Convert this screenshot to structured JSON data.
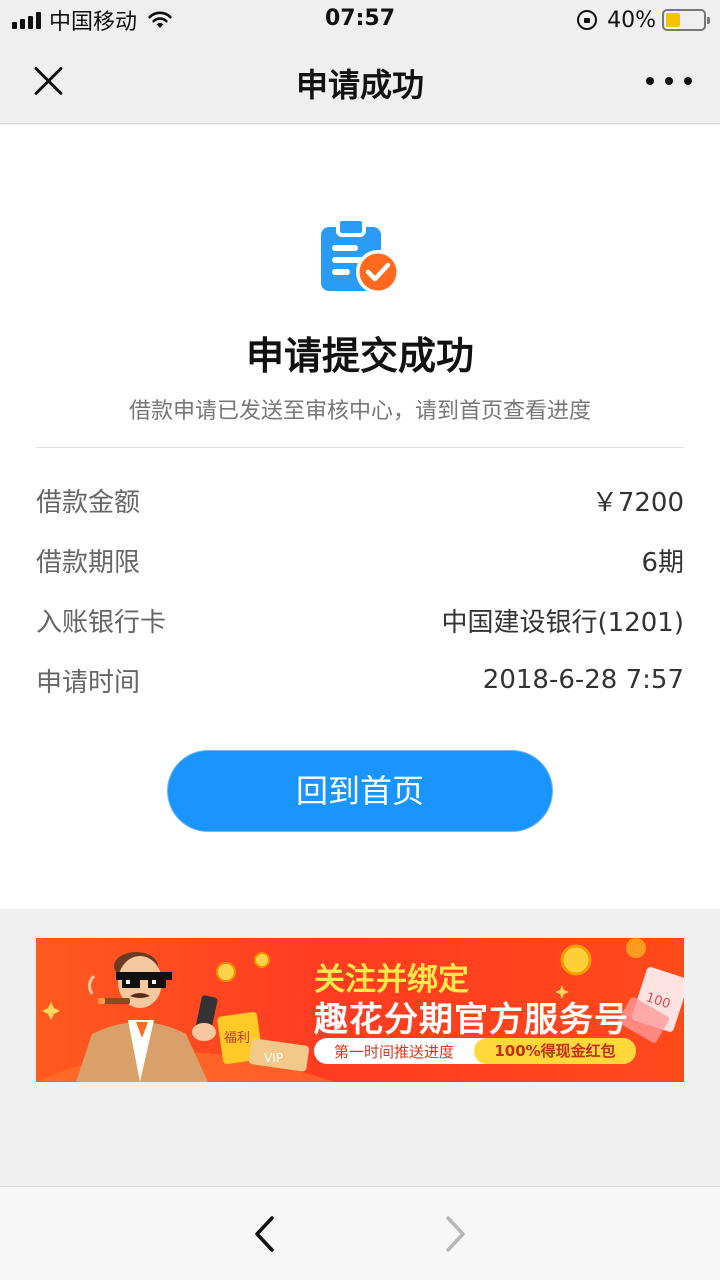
{
  "status_bar": {
    "carrier": "中国移动",
    "time": "07:57",
    "battery_percent": "40%",
    "battery_level": 0.4,
    "icons": [
      "signal-icon",
      "wifi-icon",
      "orientation-lock-icon",
      "battery-icon"
    ]
  },
  "nav": {
    "title": "申请成功",
    "close_icon": "close-icon",
    "more_icon": "more-icon"
  },
  "result": {
    "icon": "clipboard-check-icon",
    "title": "申请提交成功",
    "description": "借款申请已发送至审核中心，请到首页查看进度"
  },
  "details": [
    {
      "label": "借款金额",
      "value": "￥7200"
    },
    {
      "label": "借款期限",
      "value": "6期"
    },
    {
      "label": "入账银行卡",
      "value": "中国建设银行(1201)"
    },
    {
      "label": "申请时间",
      "value": "2018-6-28 7:57"
    }
  ],
  "home_button": {
    "label": "回到首页"
  },
  "banner": {
    "title_line1": "关注并绑定",
    "title_line2": "趣花分期官方服务号",
    "pill_left": "第一时间推送进度",
    "pill_right": "100%得现金红包",
    "badge_text": "福利",
    "vip_text": "VIP"
  },
  "toolbar": {
    "back_icon": "chevron-left-icon",
    "forward_icon": "chevron-right-icon"
  },
  "colors": {
    "accent_blue": "#1a95ff",
    "icon_blue": "#2b9cf5",
    "check_orange": "#ff6a1e",
    "banner_red": "#ff3b22",
    "battery_yellow": "#f5c400"
  }
}
